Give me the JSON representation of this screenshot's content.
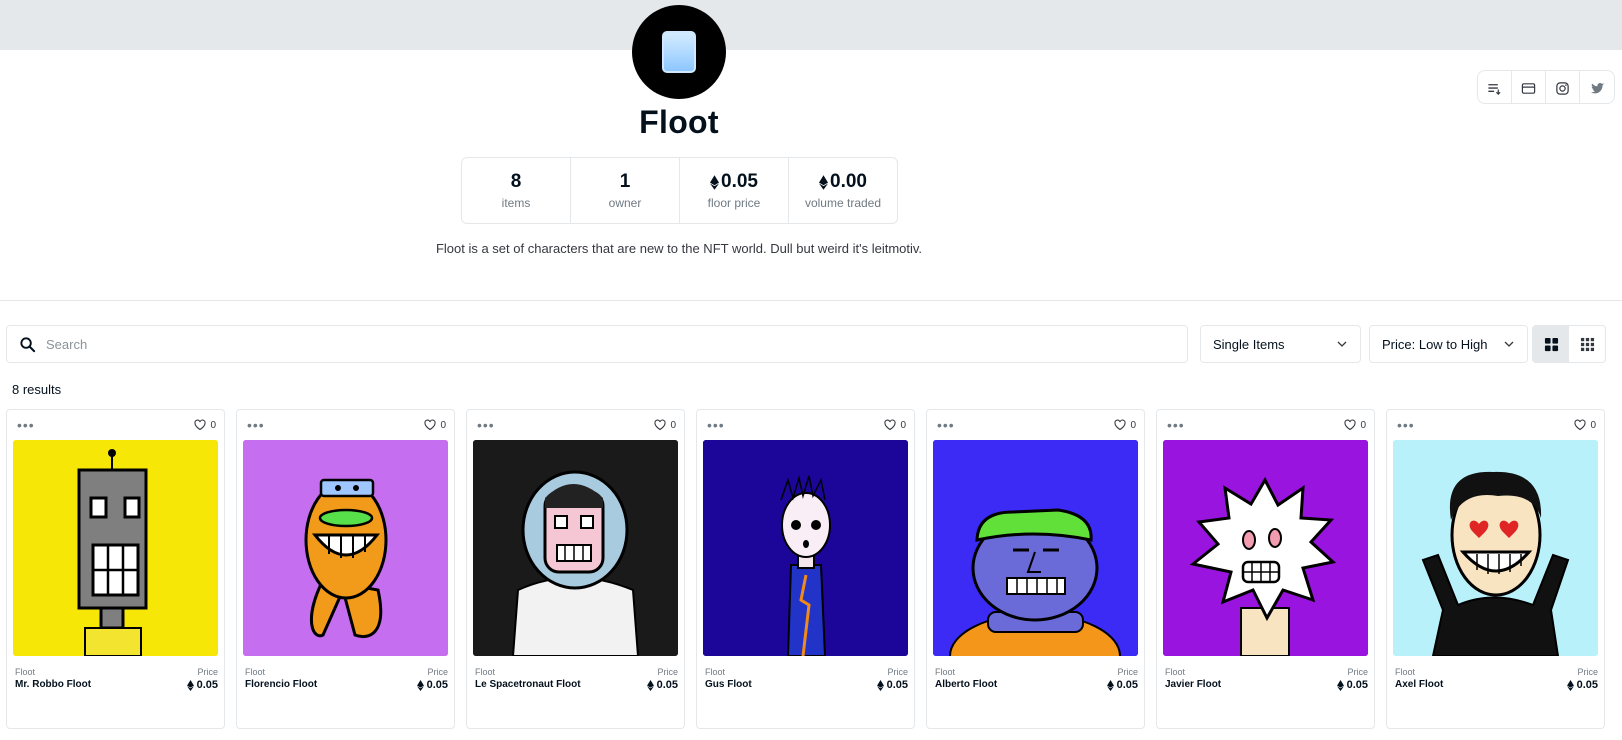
{
  "collection": {
    "name": "Floot",
    "description": "Floot is a set of characters that are new to the NFT world. Dull but weird it's leitmotiv.",
    "stats": [
      {
        "value": "8",
        "label": "items",
        "eth": false
      },
      {
        "value": "1",
        "label": "owner",
        "eth": false
      },
      {
        "value": "0.05",
        "label": "floor price",
        "eth": true
      },
      {
        "value": "0.00",
        "label": "volume traded",
        "eth": true
      }
    ]
  },
  "social": [
    "activity-icon",
    "website-icon",
    "instagram-icon",
    "twitter-icon"
  ],
  "search": {
    "placeholder": "Search"
  },
  "filters": {
    "type": "Single Items",
    "sort": "Price: Low to High"
  },
  "results_label": "8 results",
  "card_labels": {
    "price": "Price",
    "more": "•••"
  },
  "items": [
    {
      "collection": "Floot",
      "name": "Mr. Robbo Floot",
      "price": "0.05",
      "likes": "0",
      "bg": "#f7e707"
    },
    {
      "collection": "Floot",
      "name": "Florencio Floot",
      "price": "0.05",
      "likes": "0",
      "bg": "#c66ef0"
    },
    {
      "collection": "Floot",
      "name": "Le Spacetronaut Floot",
      "price": "0.05",
      "likes": "0",
      "bg": "#1a1a1a"
    },
    {
      "collection": "Floot",
      "name": "Gus Floot",
      "price": "0.05",
      "likes": "0",
      "bg": "#1c0599"
    },
    {
      "collection": "Floot",
      "name": "Alberto Floot",
      "price": "0.05",
      "likes": "0",
      "bg": "#3b2bf5"
    },
    {
      "collection": "Floot",
      "name": "Javier Floot",
      "price": "0.05",
      "likes": "0",
      "bg": "#9a14e0"
    },
    {
      "collection": "Floot",
      "name": "Axel Floot",
      "price": "0.05",
      "likes": "0",
      "bg": "#b9f1fb"
    }
  ]
}
